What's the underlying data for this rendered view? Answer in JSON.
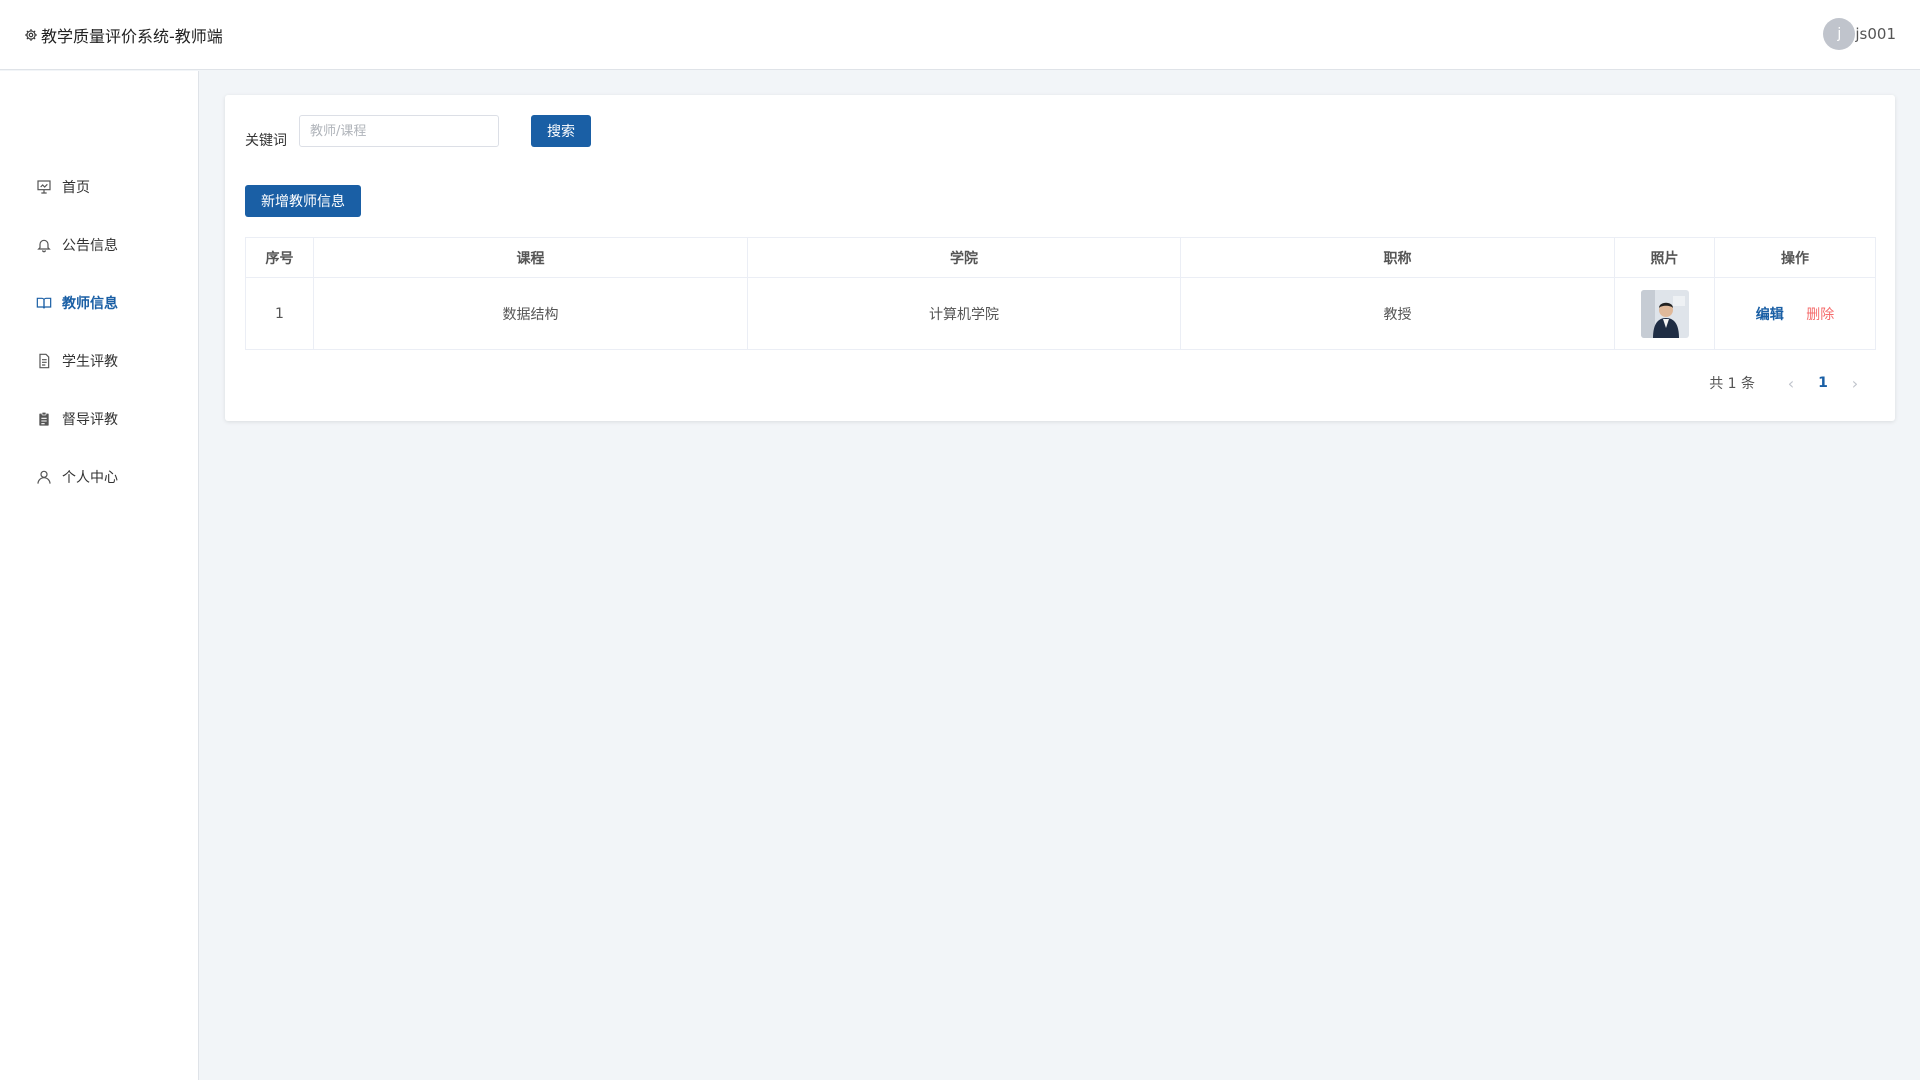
{
  "header": {
    "title": "教学质量评价系统-教师端",
    "avatar_initial": "j",
    "username": "js001"
  },
  "sidebar": {
    "items": [
      {
        "label": "首页",
        "icon": "presentation-icon",
        "active": false
      },
      {
        "label": "公告信息",
        "icon": "bell-icon",
        "active": false
      },
      {
        "label": "教师信息",
        "icon": "book-icon",
        "active": true
      },
      {
        "label": "学生评教",
        "icon": "document-icon",
        "active": false
      },
      {
        "label": "督导评教",
        "icon": "clipboard-icon",
        "active": false
      },
      {
        "label": "个人中心",
        "icon": "user-icon",
        "active": false
      }
    ]
  },
  "search": {
    "label": "关键词",
    "placeholder": "教师/课程",
    "value": "",
    "button": "搜索"
  },
  "actions": {
    "add_button": "新增教师信息"
  },
  "table": {
    "columns": [
      "序号",
      "课程",
      "学院",
      "职称",
      "照片",
      "操作"
    ],
    "rows": [
      {
        "index": "1",
        "course": "数据结构",
        "college": "计算机学院",
        "title": "教授"
      }
    ],
    "edit_label": "编辑",
    "delete_label": "删除"
  },
  "pagination": {
    "total_text": "共 1 条",
    "current_page": "1",
    "prev": "‹",
    "next": "›"
  },
  "colors": {
    "primary": "#1a5fa5",
    "danger": "#f56c6c",
    "background": "#f2f5f8"
  }
}
